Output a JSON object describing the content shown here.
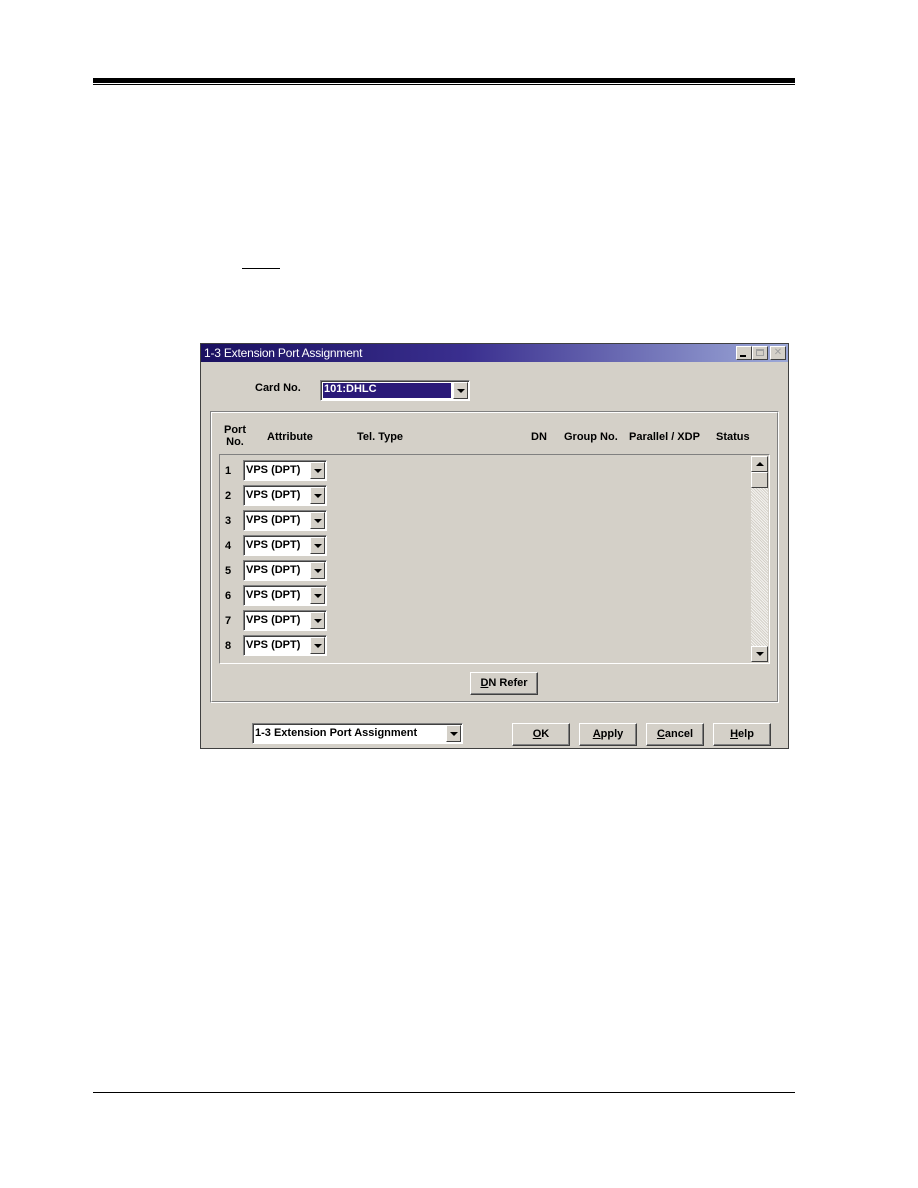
{
  "document": {
    "note_marker": ""
  },
  "window": {
    "title": "1-3 Extension Port Assignment",
    "buttons": {
      "minimize": {
        "enabled": true
      },
      "maximize": {
        "enabled": false
      },
      "close": {
        "enabled": false
      }
    },
    "card_no": {
      "label": "Card No.",
      "value": "101:DHLC"
    },
    "table": {
      "columns": [
        {
          "key": "port",
          "label_line1": "Port",
          "label_line2": "No."
        },
        {
          "key": "attribute",
          "label": "Attribute"
        },
        {
          "key": "tel_type",
          "label": "Tel. Type"
        },
        {
          "key": "dn",
          "label": "DN"
        },
        {
          "key": "group_no",
          "label": "Group No."
        },
        {
          "key": "parallel_xdp",
          "label": "Parallel / XDP"
        },
        {
          "key": "status",
          "label": "Status"
        }
      ],
      "rows": [
        {
          "port": "1",
          "attribute": "VPS (DPT)"
        },
        {
          "port": "2",
          "attribute": "VPS (DPT)"
        },
        {
          "port": "3",
          "attribute": "VPS (DPT)"
        },
        {
          "port": "4",
          "attribute": "VPS (DPT)"
        },
        {
          "port": "5",
          "attribute": "VPS (DPT)"
        },
        {
          "port": "6",
          "attribute": "VPS (DPT)"
        },
        {
          "port": "7",
          "attribute": "VPS (DPT)"
        },
        {
          "port": "8",
          "attribute": "VPS (DPT)"
        }
      ]
    },
    "dn_refer": {
      "mnemonic": "D",
      "rest": "N Refer"
    },
    "screen_select": {
      "value": "1-3 Extension Port Assignment"
    },
    "footer_buttons": {
      "ok": {
        "mnemonic": "O",
        "rest": "K"
      },
      "apply": {
        "mnemonic": "A",
        "rest": "pply"
      },
      "cancel": {
        "mnemonic": "C",
        "rest": "ancel"
      },
      "help": {
        "mnemonic": "H",
        "rest": "elp"
      }
    }
  }
}
